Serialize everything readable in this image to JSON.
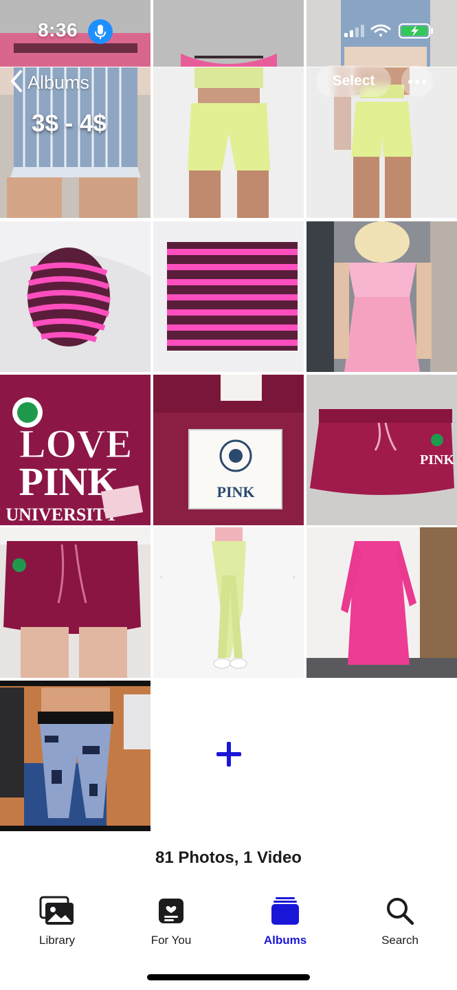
{
  "status_bar": {
    "time": "8:36",
    "mic_icon": "mic-icon",
    "signal_icon": "cellular-signal-icon",
    "wifi_icon": "wifi-icon",
    "battery_icon": "battery-charging-icon",
    "battery_color": "#34c759"
  },
  "nav": {
    "back_label": "Albums",
    "select_label": "Select",
    "more_icon": "ellipsis-icon"
  },
  "price_overlay": "3$ - 4$",
  "photos": [
    {
      "name": "denim-shorts-top"
    },
    {
      "name": "pink-bikini-top"
    },
    {
      "name": "denim-shorts-top-right"
    },
    {
      "name": "denim-shorts-photo"
    },
    {
      "name": "lime-set-front"
    },
    {
      "name": "lime-set-back"
    },
    {
      "name": "striped-bucket-hat"
    },
    {
      "name": "striped-knit-scarf"
    },
    {
      "name": "pink-crochet-top"
    },
    {
      "name": "love-pink-sweatpants"
    },
    {
      "name": "pink-label-tag"
    },
    {
      "name": "maroon-skirt-flat"
    },
    {
      "name": "maroon-skirt-worn"
    },
    {
      "name": "lime-leggings"
    },
    {
      "name": "pink-knit-dress"
    },
    {
      "name": "printed-leggings"
    }
  ],
  "overlay_text": {
    "love": "LOVE",
    "pink": "PINK",
    "university": "UNIVERSITY",
    "tag_brand": "PINK",
    "skirt_print": "PINK"
  },
  "add_icon": "plus-icon",
  "accent_color": "#1a16d8",
  "summary": "81 Photos, 1 Video",
  "tabs": [
    {
      "label": "Library",
      "icon": "photo-library-icon",
      "active": false
    },
    {
      "label": "For You",
      "icon": "for-you-icon",
      "active": false
    },
    {
      "label": "Albums",
      "icon": "albums-icon",
      "active": true
    },
    {
      "label": "Search",
      "icon": "search-icon",
      "active": false
    }
  ]
}
